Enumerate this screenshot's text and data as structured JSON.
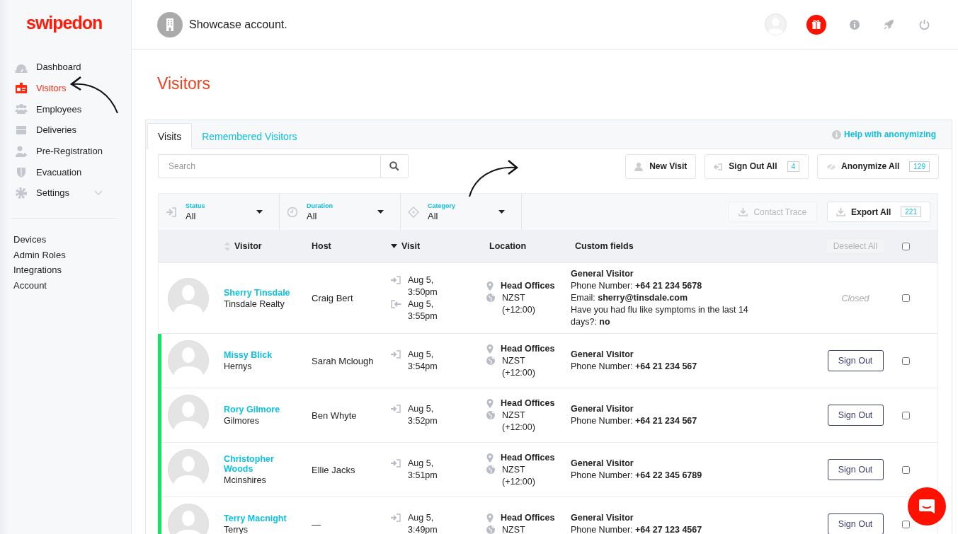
{
  "brand": {
    "logo": "swipedon"
  },
  "sidebar": {
    "items": [
      {
        "label": "Dashboard",
        "selected": false,
        "kind": "link"
      },
      {
        "label": "Visitors",
        "selected": true,
        "kind": "link"
      },
      {
        "label": "Employees",
        "selected": false,
        "kind": "link"
      },
      {
        "label": "Deliveries",
        "selected": false,
        "kind": "link"
      },
      {
        "label": "Pre-Registration",
        "selected": false,
        "kind": "link"
      },
      {
        "label": "Evacuation",
        "selected": false,
        "kind": "link"
      },
      {
        "label": "Settings",
        "selected": false,
        "kind": "group"
      }
    ],
    "links": [
      "Devices",
      "Admin Roles",
      "Integrations",
      "Account"
    ]
  },
  "header": {
    "account": "Showcase account."
  },
  "page_title": "Visitors",
  "tabs": [
    {
      "label": "Visits",
      "selected": true
    },
    {
      "label": "Remembered Visitors",
      "selected": false
    }
  ],
  "help_link": "Help with anonymizing",
  "search": {
    "placeholder": "Search"
  },
  "actions": [
    {
      "label": "New Visit"
    },
    {
      "label": "Sign Out All",
      "count": "4"
    },
    {
      "label": "Anonymize All",
      "count": "129"
    }
  ],
  "filters": [
    {
      "label": "Status",
      "value": "All"
    },
    {
      "label": "Duration",
      "value": "All"
    },
    {
      "label": "Category",
      "value": "All"
    }
  ],
  "export_actions": [
    {
      "label": "Contact Trace",
      "disabled": true
    },
    {
      "label": "Export All",
      "count": "221",
      "disabled": false
    }
  ],
  "table": {
    "columns": [
      {
        "label": "Visitor",
        "sortable": true,
        "sorted": false
      },
      {
        "label": "Host",
        "sortable": false,
        "sorted": false
      },
      {
        "label": "Visit",
        "sortable": false,
        "sorted": true
      },
      {
        "label": "Location",
        "sortable": false,
        "sorted": false
      },
      {
        "label": "Custom fields",
        "sortable": false,
        "sorted": false
      }
    ],
    "deselect_all": {
      "label": "Deselect All",
      "disabled": true
    },
    "select_all": {
      "checked": false
    },
    "rows": [
      {
        "name": "Sherry Tinsdale",
        "company": "Tinsdale Realty",
        "host": "Craig Bert",
        "visits": [
          {
            "kind": "in",
            "time": "Aug 5, 3:50pm"
          },
          {
            "kind": "out",
            "time": "Aug 5, 3:55pm"
          }
        ],
        "location": "Head Offices",
        "timezone": "NZST (+12:00)",
        "category": "General Visitor",
        "fields": [
          "Phone Number: **+64 21 234 5678**",
          "Email: **sherry@tinsdale.com**",
          "Have you had flu like symptoms in the last 14 days?: **no**"
        ],
        "signed_in": false,
        "action": "Closed",
        "checked": false
      },
      {
        "name": "Missy Blick",
        "company": "Hernys",
        "host": "Sarah Mclough",
        "visits": [
          {
            "kind": "in",
            "time": "Aug 5, 3:54pm"
          }
        ],
        "location": "Head Offices",
        "timezone": "NZST (+12:00)",
        "category": "General Visitor",
        "fields": [
          "Phone Number: **+64 21 234 567**"
        ],
        "signed_in": true,
        "action": "Sign Out",
        "checked": false
      },
      {
        "name": "Rory Gilmore",
        "company": "Gilmores",
        "host": "Ben Whyte",
        "visits": [
          {
            "kind": "in",
            "time": "Aug 5, 3:52pm"
          }
        ],
        "location": "Head Offices",
        "timezone": "NZST (+12:00)",
        "category": "General Visitor",
        "fields": [
          "Phone Number: **+64 21 234 567**"
        ],
        "signed_in": true,
        "action": "Sign Out",
        "checked": false
      },
      {
        "name": "Christopher Woods",
        "company": "Mcinshires",
        "host": "Ellie Jacks",
        "visits": [
          {
            "kind": "in",
            "time": "Aug 5, 3:51pm"
          }
        ],
        "location": "Head Offices",
        "timezone": "NZST (+12:00)",
        "category": "General Visitor",
        "fields": [
          "Phone Number: **+64 22 345 6789**"
        ],
        "signed_in": true,
        "action": "Sign Out",
        "checked": false
      },
      {
        "name": "Terry Macnight",
        "company": "Terrys",
        "host": "—",
        "visits": [
          {
            "kind": "in",
            "time": "Aug 5, 3:49pm"
          }
        ],
        "location": "Head Offices",
        "timezone": "NZST",
        "category": "General Visitor",
        "fields": [
          "Phone Number: **+64 27 123 4567**"
        ],
        "signed_in": true,
        "action": "Sign Out",
        "checked": false
      }
    ]
  }
}
